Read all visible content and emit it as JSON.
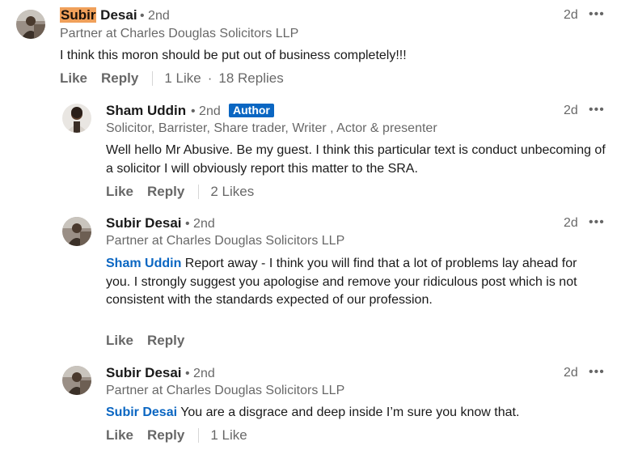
{
  "comments": [
    {
      "name_first": "Subir",
      "name_rest": " Desai",
      "degree": "• 2nd",
      "headline": "Partner at Charles Douglas Solicitors LLP",
      "time": "2d",
      "menu": "•••",
      "text": "I think this moron should be put out of business completely!!!",
      "like": "Like",
      "reply": "Reply",
      "likes_count": "1 Like",
      "dot": "·",
      "replies_count": "18 Replies"
    }
  ],
  "replies": [
    {
      "name": "Sham Uddin",
      "degree": "• 2nd",
      "badge": "Author",
      "headline": "Solicitor, Barrister, Share trader, Writer , Actor & presenter",
      "time": "2d",
      "menu": "•••",
      "text": "Well hello Mr Abusive. Be my guest. I think this particular text is conduct unbecoming of a solicitor I will obviously report this matter to the SRA.",
      "like": "Like",
      "reply": "Reply",
      "likes_count": "2 Likes"
    },
    {
      "name": "Subir Desai",
      "degree": "• 2nd",
      "headline": "Partner at Charles Douglas Solicitors LLP",
      "time": "2d",
      "menu": "•••",
      "mention": "Sham Uddin",
      "text": " Report away - I think you will find that a lot of problems lay ahead for you. I strongly suggest you apologise and remove your ridiculous post which is not consistent with the standards expected of our profession.",
      "like": "Like",
      "reply": "Reply"
    },
    {
      "name": "Subir Desai",
      "degree": "• 2nd",
      "headline": "Partner at Charles Douglas Solicitors LLP",
      "time": "2d",
      "menu": "•••",
      "mention": "Subir Desai",
      "text": " You are a disgrace and deep inside I’m sure you know that.",
      "like": "Like",
      "reply": "Reply",
      "likes_count": "1 Like"
    }
  ],
  "colors": {
    "link_blue": "#0a66c2",
    "highlight": "#f0a05a",
    "secondary_text": "#666666"
  },
  "icons": {
    "menu": "more-horizontal-icon"
  }
}
